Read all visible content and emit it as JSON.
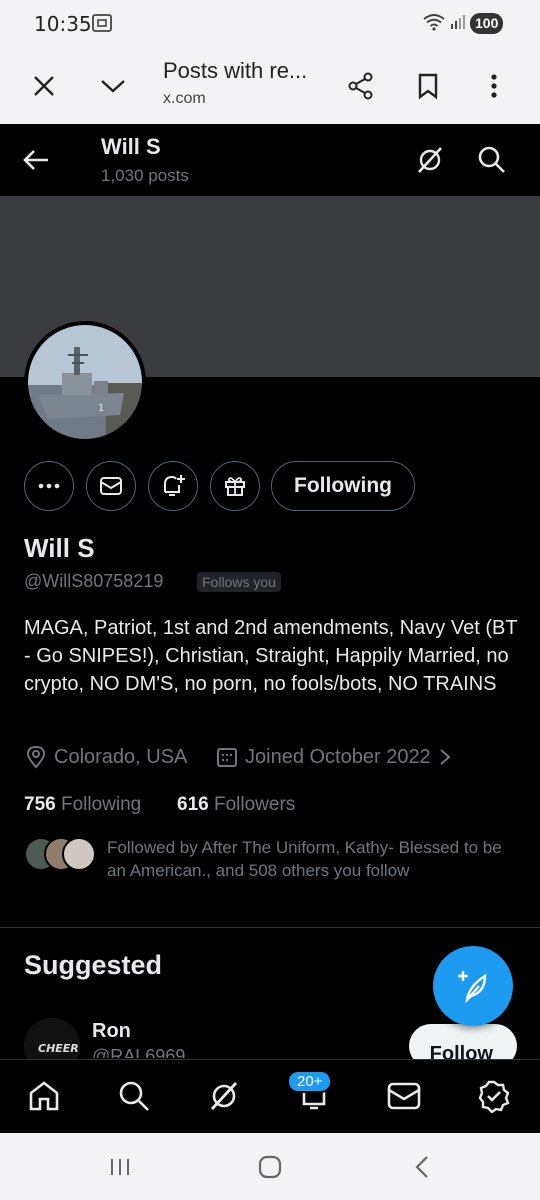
{
  "status_bar": {
    "time": "10:35",
    "battery": "100"
  },
  "custom_tab": {
    "title": "Posts with re...",
    "url": "x.com"
  },
  "header": {
    "name": "Will S",
    "post_count": "1,030 posts"
  },
  "profile": {
    "display_name": "Will S",
    "handle": "@WillS80758219",
    "follows_you_badge": "Follows you",
    "bio": "MAGA, Patriot, 1st and 2nd amendments, Navy Vet (BT - Go SNIPES!), Christian, Straight, Happily Married, no crypto, NO DM'S, no porn, no fools/bots, NO TRAINS",
    "location": "Colorado, USA",
    "joined": "Joined October 2022",
    "following_count": "756",
    "following_label": "Following",
    "followers_count": "616",
    "followers_label": "Followers",
    "followed_by": "Followed by After The Uniform, Kathy- Blessed to be an American., and 508 others you follow"
  },
  "actions": {
    "following_button": "Following"
  },
  "suggested": {
    "title": "Suggested",
    "user_name": "Ron",
    "user_handle": "@RAL6969",
    "follow_button": "Follow"
  },
  "bottom_nav": {
    "notifications_badge": "20+"
  },
  "colors": {
    "accent": "#1d9bf0",
    "text": "#e7e9ea",
    "muted": "#71767b",
    "border": "#536471"
  }
}
